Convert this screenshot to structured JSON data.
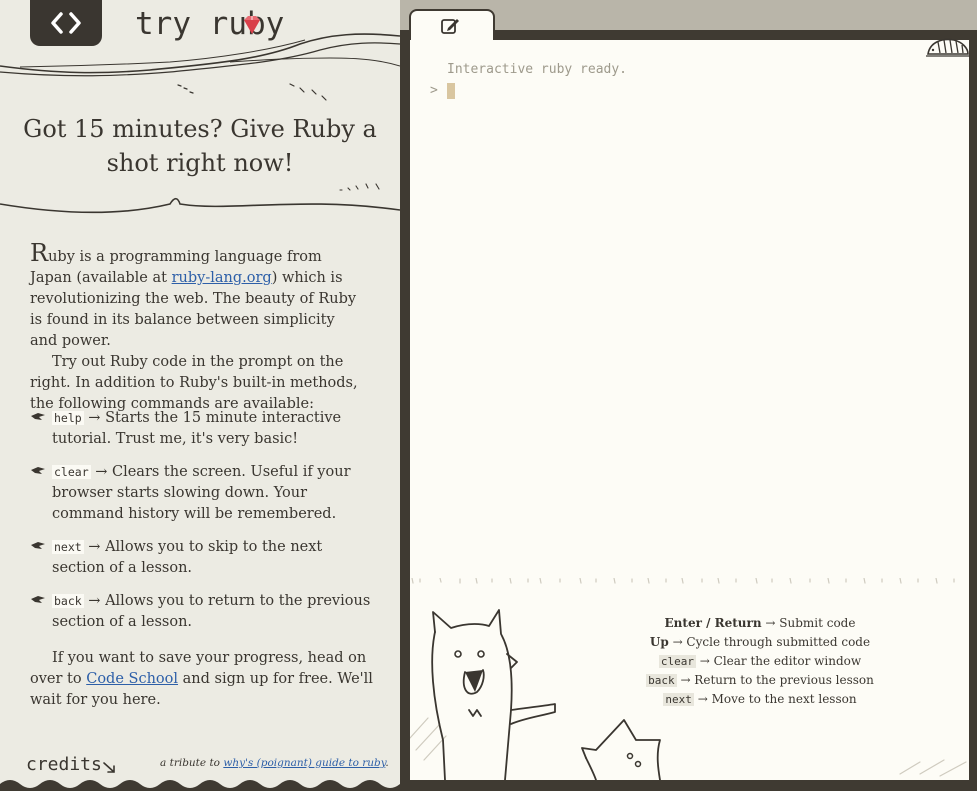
{
  "sidebar": {
    "brand": "try ruby",
    "headline": "Got 15 minutes? Give Ruby a shot right now!",
    "intro": {
      "dropcap": "R",
      "p1_a": "uby is a programming language from Japan (available at ",
      "p1_link": "ruby-lang.org",
      "p1_b": ") which is revolutionizing the web. The beauty of Ruby is found in its balance between simplicity and power.",
      "p2": "Try out Ruby code in the prompt on the right. In addition to Ruby's built-in methods, the following commands are available:"
    },
    "commands": [
      {
        "cmd": "help",
        "desc": " → Starts the 15 minute interactive tutorial. Trust me, it's very basic!"
      },
      {
        "cmd": "clear",
        "desc": " → Clears the screen. Useful if your browser starts slowing down. Your command history will be remembered."
      },
      {
        "cmd": "next",
        "desc": " → Allows you to skip to the next section of a lesson."
      },
      {
        "cmd": "back",
        "desc": " → Allows you to return to the previous section of a lesson."
      }
    ],
    "save_note": {
      "a": "If you want to save your progress, head on over to ",
      "link": "Code School",
      "b": " and sign up for free. We'll wait for you here."
    },
    "credits_label": "credits",
    "tribute": {
      "prefix": "a tribute to ",
      "link": "why's (poignant) guide to ruby",
      "suffix": "."
    }
  },
  "console": {
    "ready_message": "Interactive ruby ready.",
    "prompt_symbol": ">",
    "input_value": ""
  },
  "shortcuts": [
    {
      "key": "Enter / Return",
      "desc": " → Submit code",
      "style": "bold"
    },
    {
      "key": "Up",
      "desc": " → Cycle through submitted code",
      "style": "bold"
    },
    {
      "key": "clear",
      "desc": " → Clear the editor window",
      "style": "code"
    },
    {
      "key": "back",
      "desc": " → Return to the previous lesson",
      "style": "code"
    },
    {
      "key": "next",
      "desc": " → Move to the next lesson",
      "style": "code"
    }
  ],
  "icons": {
    "logo": "code-brackets-icon",
    "gem": "ruby-gem-icon",
    "tab": "edit-icon",
    "bullet": "pointing-hand-icon",
    "corner": "bug-icon"
  },
  "colors": {
    "sidebar_bg": "#ecebe3",
    "ink": "#3a3630",
    "link": "#2d5fa8",
    "console_bg": "#fdfcf6",
    "frame": "#3f3a32",
    "gem": "#d9404a"
  }
}
